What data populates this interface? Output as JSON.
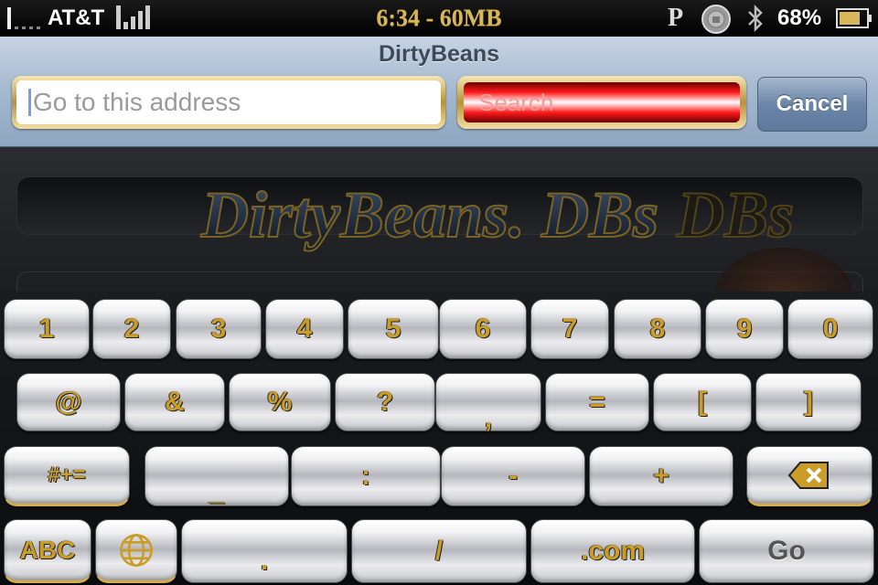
{
  "status_bar": {
    "carrier": "AT&T",
    "clock": "6:34 - 60MB",
    "p_glyph": "P",
    "battery": "68%",
    "icons": [
      "signal-dots-icon",
      "signal-bars-icon",
      "lock-status-icon",
      "bluetooth-icon",
      "battery-icon"
    ]
  },
  "nav": {
    "title": "DirtyBeans",
    "address_placeholder": "Go to this address",
    "search_placeholder": "Search",
    "cancel_label": "Cancel"
  },
  "content": {
    "logo_text": "DirtyBeans. DBs",
    "logo_echo": "DBs"
  },
  "keyboard": {
    "row1": [
      "1",
      "2",
      "3",
      "4",
      "5",
      "6",
      "7",
      "8",
      "9",
      "0"
    ],
    "row2": [
      "@",
      "&",
      "%",
      "?",
      ",",
      "=",
      "[",
      "]"
    ],
    "row3": [
      "#+=",
      "_",
      ":",
      "-",
      "+"
    ],
    "row4": [
      "ABC",
      ".",
      "/",
      ".com",
      "Go"
    ],
    "icons": [
      "backspace-icon",
      "globe-icon"
    ]
  },
  "colors": {
    "accent_gold": "#c99d27",
    "nav_blue": "#8ea6c2",
    "search_red": "#ff1a1a"
  }
}
